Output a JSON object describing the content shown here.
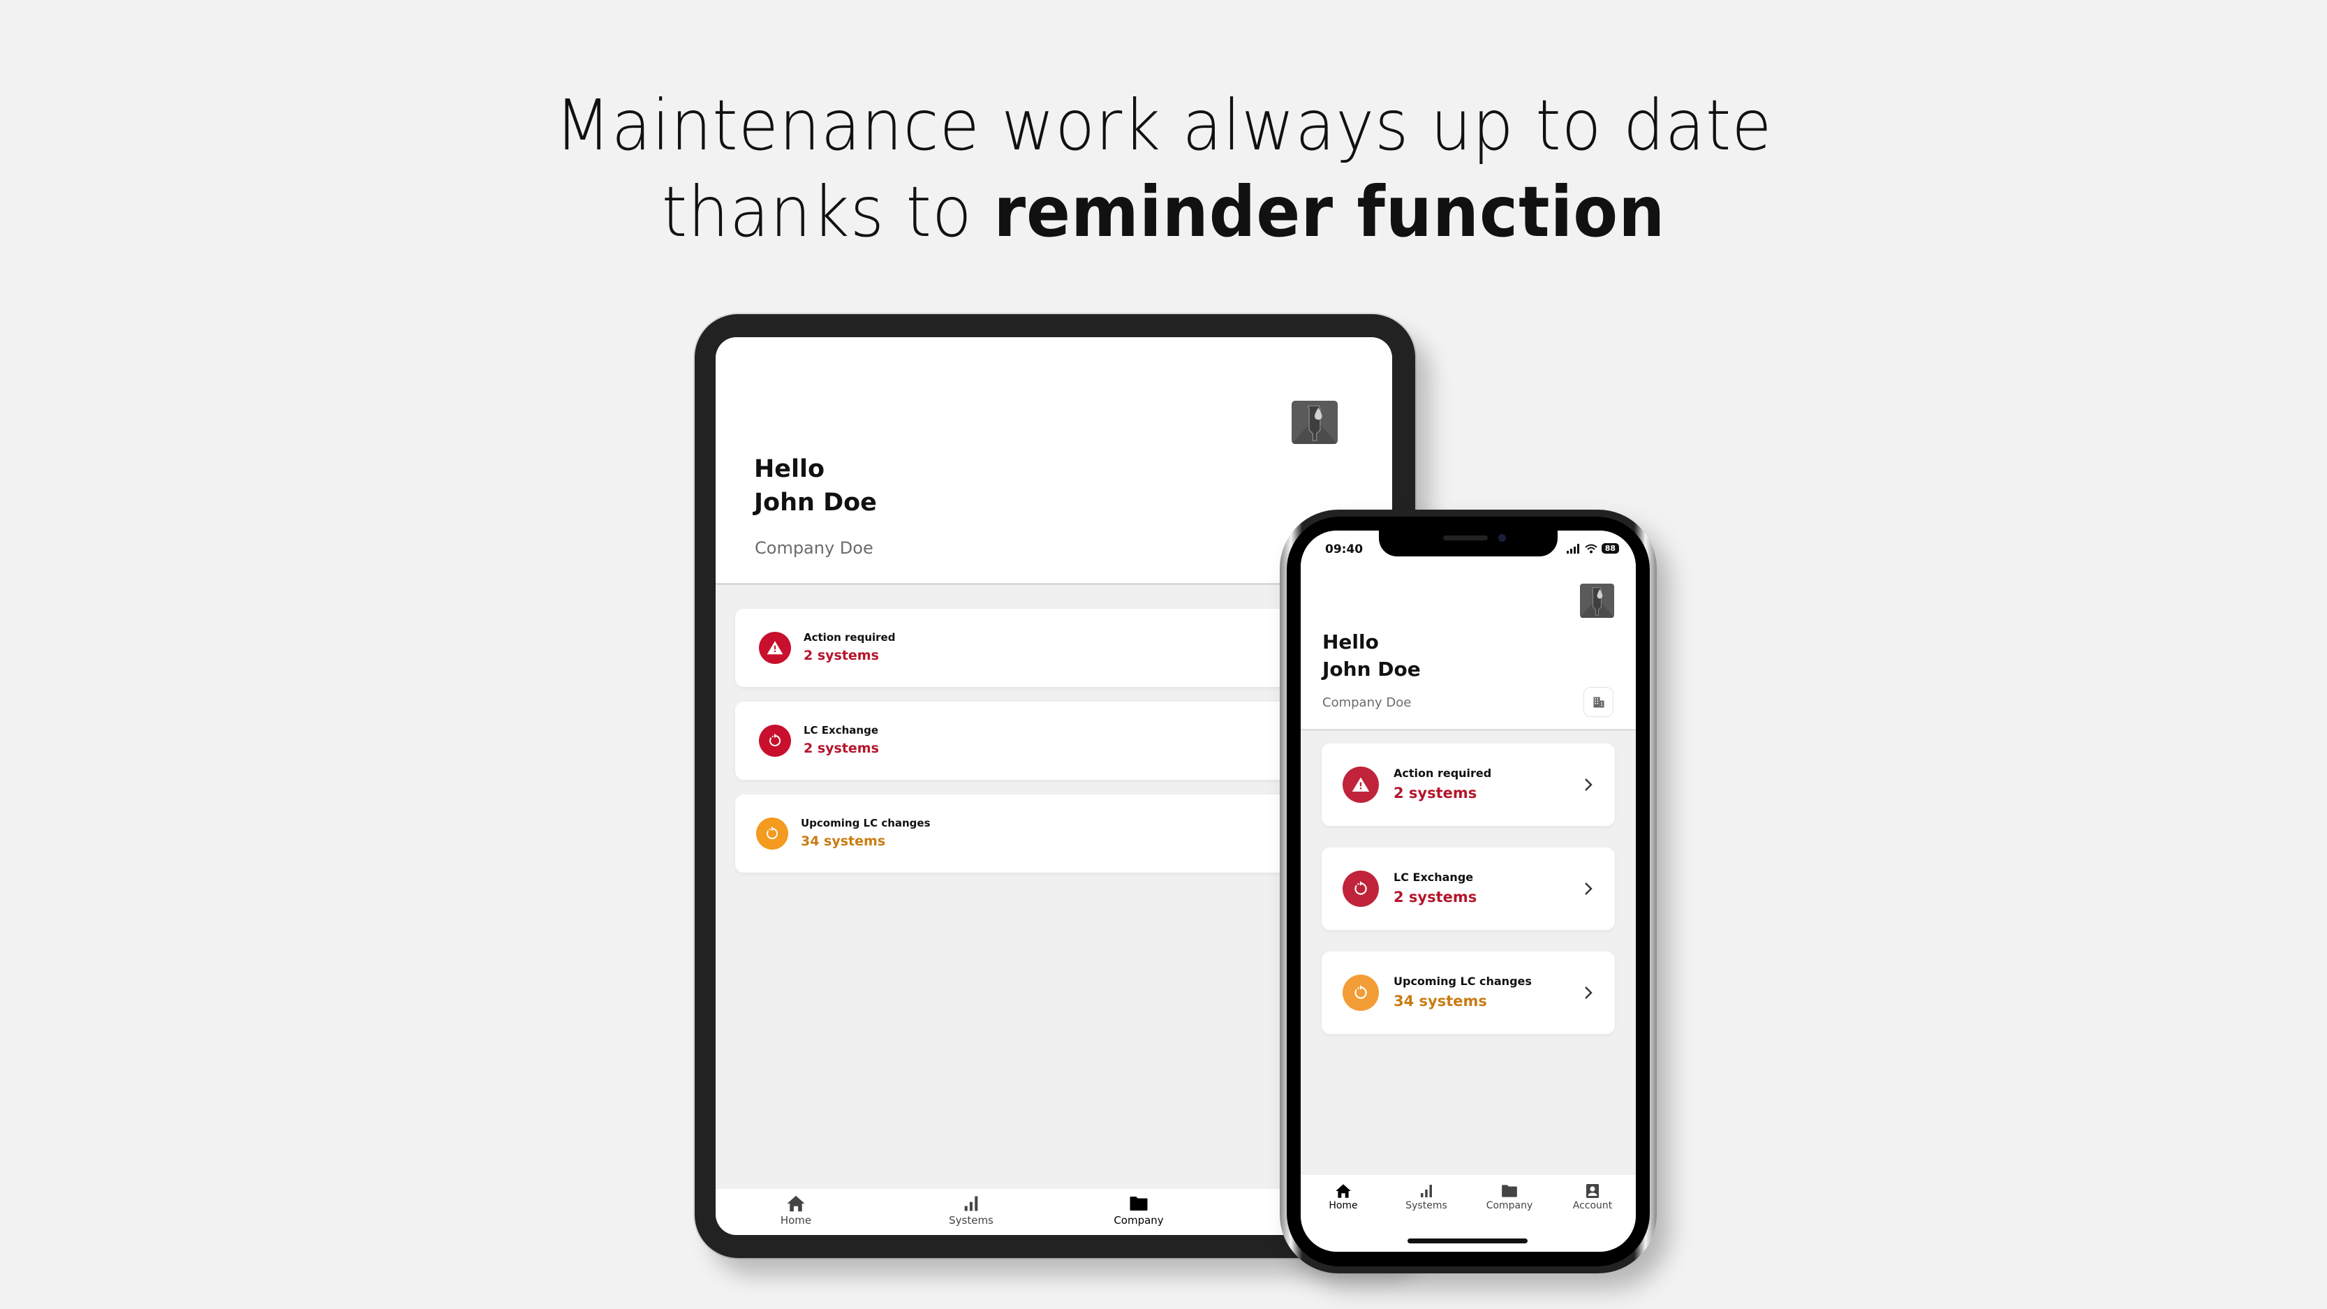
{
  "headline": {
    "line1": "Maintenance work always up to date",
    "line2_regular": "thanks to ",
    "line2_bold": "reminder function"
  },
  "colors": {
    "critical": "#c8102e",
    "critical_text": "#b5152b",
    "warning": "#f39a1f",
    "warning_text": "#c97c12",
    "background": "#f2f2f2"
  },
  "tablet": {
    "greeting": "Hello",
    "user_name": "John Doe",
    "company": "Company Doe",
    "cards": [
      {
        "title": "Action required",
        "value": "2 systems",
        "icon": "warning-icon",
        "severity": "critical"
      },
      {
        "title": "LC Exchange",
        "value": "2 systems",
        "icon": "refresh-icon",
        "severity": "critical"
      },
      {
        "title": "Upcoming LC changes",
        "value": "34 systems",
        "icon": "refresh-icon",
        "severity": "warning"
      }
    ],
    "tabs": [
      {
        "label": "Home",
        "icon": "home-icon",
        "active": false
      },
      {
        "label": "Systems",
        "icon": "bar-chart-icon",
        "active": false
      },
      {
        "label": "Company",
        "icon": "folder-icon",
        "active": true
      }
    ]
  },
  "phone": {
    "status_time": "09:40",
    "battery": "88",
    "greeting": "Hello",
    "user_name": "John Doe",
    "company": "Company Doe",
    "cards": [
      {
        "title": "Action required",
        "value": "2 systems",
        "icon": "warning-icon",
        "severity": "critical"
      },
      {
        "title": "LC Exchange",
        "value": "2 systems",
        "icon": "refresh-icon",
        "severity": "critical"
      },
      {
        "title": "Upcoming LC changes",
        "value": "34 systems",
        "icon": "refresh-icon",
        "severity": "warning"
      }
    ],
    "tabs": [
      {
        "label": "Home",
        "icon": "home-icon",
        "active": true
      },
      {
        "label": "Systems",
        "icon": "bar-chart-icon",
        "active": false
      },
      {
        "label": "Company",
        "icon": "folder-icon",
        "active": false
      },
      {
        "label": "Account",
        "icon": "account-icon",
        "active": false
      }
    ]
  }
}
